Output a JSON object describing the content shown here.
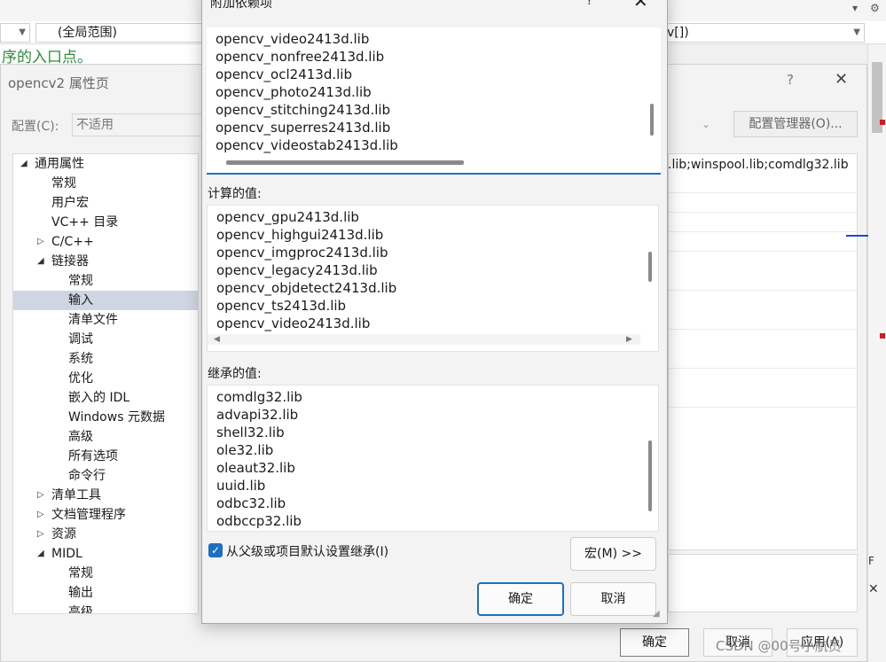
{
  "editor": {
    "scope_combo": "(全局范围)",
    "member_combo_tail": "v[])",
    "comment_text": "序的入口点。",
    "top_icons": [
      "▾",
      "⚙"
    ]
  },
  "property_pages": {
    "title": "opencv2 属性页",
    "help": "?",
    "close": "✕",
    "config_label": "配置(C):",
    "config_value": "不适用",
    "config_manager_button": "配置管理器(O)...",
    "grid_visible_value": ".lib;winspool.lib;comdlg32.lib",
    "description_letter": "F",
    "description_close": "✕",
    "tree": [
      {
        "label": "通用属性",
        "level": 0,
        "twisty": "◢"
      },
      {
        "label": "常规",
        "level": 1,
        "twisty": ""
      },
      {
        "label": "用户宏",
        "level": 1,
        "twisty": ""
      },
      {
        "label": "VC++ 目录",
        "level": 1,
        "twisty": ""
      },
      {
        "label": "C/C++",
        "level": 1,
        "twisty": "▷"
      },
      {
        "label": "链接器",
        "level": 1,
        "twisty": "◢"
      },
      {
        "label": "常规",
        "level": 2,
        "twisty": ""
      },
      {
        "label": "输入",
        "level": 2,
        "twisty": "",
        "selected": true
      },
      {
        "label": "清单文件",
        "level": 2,
        "twisty": ""
      },
      {
        "label": "调试",
        "level": 2,
        "twisty": ""
      },
      {
        "label": "系统",
        "level": 2,
        "twisty": ""
      },
      {
        "label": "优化",
        "level": 2,
        "twisty": ""
      },
      {
        "label": "嵌入的 IDL",
        "level": 2,
        "twisty": ""
      },
      {
        "label": "Windows 元数据",
        "level": 2,
        "twisty": ""
      },
      {
        "label": "高级",
        "level": 2,
        "twisty": ""
      },
      {
        "label": "所有选项",
        "level": 2,
        "twisty": ""
      },
      {
        "label": "命令行",
        "level": 2,
        "twisty": ""
      },
      {
        "label": "清单工具",
        "level": 1,
        "twisty": "▷"
      },
      {
        "label": "文档管理程序",
        "level": 1,
        "twisty": "▷"
      },
      {
        "label": "资源",
        "level": 1,
        "twisty": "▷"
      },
      {
        "label": "MIDL",
        "level": 1,
        "twisty": "◢"
      },
      {
        "label": "常规",
        "level": 2,
        "twisty": ""
      },
      {
        "label": "输出",
        "level": 2,
        "twisty": ""
      },
      {
        "label": "高级",
        "level": 2,
        "twisty": ""
      }
    ],
    "ok_button": "确定",
    "cancel_button": "取消",
    "apply_button": "应用(A)"
  },
  "watermark": "CSDN @00号小航员",
  "dialog": {
    "title": "附加依赖项",
    "help": "?",
    "close": "✕",
    "edit_items": [
      "opencv_video2413d.lib",
      "opencv_nonfree2413d.lib",
      "opencv_ocl2413d.lib",
      "opencv_photo2413d.lib",
      "opencv_stitching2413d.lib",
      "opencv_superres2413d.lib",
      "opencv_videostab2413d.lib"
    ],
    "computed_label": "计算的值:",
    "computed_items": [
      "opencv_gpu2413d.lib",
      "opencv_highgui2413d.lib",
      "opencv_imgproc2413d.lib",
      "opencv_legacy2413d.lib",
      "opencv_objdetect2413d.lib",
      "opencv_ts2413d.lib",
      "opencv_video2413d.lib"
    ],
    "inherited_label": "继承的值:",
    "inherited_items": [
      "comdlg32.lib",
      "advapi32.lib",
      "shell32.lib",
      "ole32.lib",
      "oleaut32.lib",
      "uuid.lib",
      "odbc32.lib",
      "odbccp32.lib"
    ],
    "inherit_checkbox_label": "从父级或项目默认设置继承(I)",
    "inherit_checked": true,
    "macro_button": "宏(M) >>",
    "ok_button": "确定",
    "cancel_button": "取消",
    "accent_color": "#1f6fbf"
  }
}
